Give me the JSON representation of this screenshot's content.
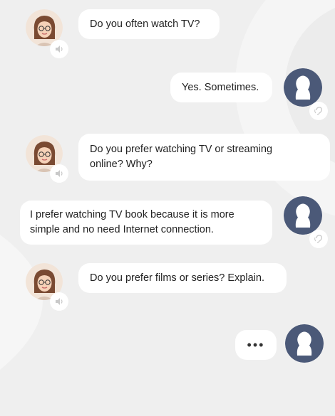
{
  "chat": {
    "messages": [
      {
        "sender": "bot",
        "text": "Do you often watch TV?"
      },
      {
        "sender": "user",
        "text": "Yes. Sometimes."
      },
      {
        "sender": "bot",
        "text_line1": "Do you prefer watching TV or streaming",
        "text_line2": "online? Why?"
      },
      {
        "sender": "user",
        "text_line1": "I prefer watching TV book because it is more",
        "text_line2": "simple and no need Internet connection."
      },
      {
        "sender": "bot",
        "text": "Do you prefer films or series? Explain."
      },
      {
        "sender": "user",
        "typing": "•••"
      }
    ],
    "colors": {
      "background": "#efefef",
      "bubble": "#ffffff",
      "user_avatar": "#4b5978",
      "bot_hair": "#7a4a32"
    },
    "icons": {
      "bot_audio": "speaker-icon",
      "user_audio": "ear-icon",
      "user_avatar": "person-silhouette-icon",
      "bot_avatar": "woman-with-glasses-avatar"
    }
  }
}
